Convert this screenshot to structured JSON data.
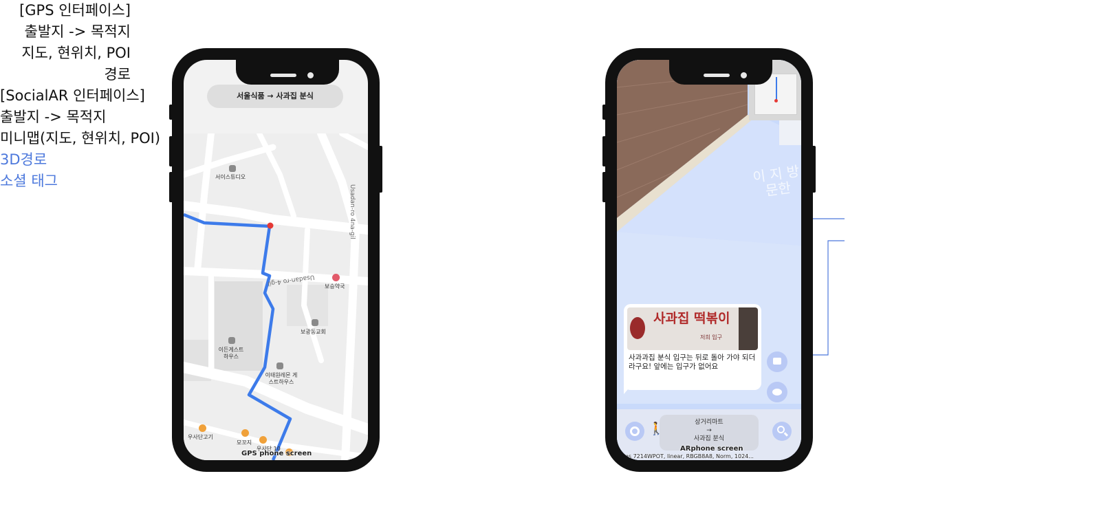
{
  "left_annotation": {
    "lines": [
      "[GPS 인터페이스]",
      "출발지 -> 목적지",
      "지도, 현위치, POI",
      "경로"
    ]
  },
  "right_annotation": {
    "lines": [
      "[SocialAR 인터페이스]",
      "출발지 -> 목적지",
      "미니맵(지도, 현위치, POI)"
    ],
    "route_label": "3D경로",
    "tag_label": "소셜 태그"
  },
  "gps_phone": {
    "route_text": "서울식품  → 사과집 분식",
    "street_labels": [
      "Usadan-ro 4na-gil",
      "Usadan-ro 4-gil"
    ],
    "pois": [
      "서이스튜디오",
      "보승약국",
      "보광동교회",
      "이든게스트하우스",
      "이태원레몬 게스트하우스",
      "우사단고기",
      "모꼬지",
      "우사단 10"
    ],
    "caption": "GPS phone screen",
    "colors": {
      "route": "#3d7bea",
      "current_location": "#e53935",
      "poi_orange": "#f0a13a"
    }
  },
  "ar_phone": {
    "sign_text": "사과집 떡볶이",
    "sign_subtext": "저희 입구",
    "tag_message": "사과과집 분식 입구는 뒤로 돌아 가야 되더라구요! 앞에는 입구가 없어요",
    "wall_text": "이 지 방문한",
    "nav_from": "상거리마트",
    "nav_arrow": "→",
    "nav_to": "사과집 분식",
    "caption": "ARphone screen",
    "debug_text": "0ms 7214WPOT, linear, RBGB8A8, Norm, 1024...",
    "icons": [
      "settings-icon",
      "walk-icon",
      "search-icon",
      "chat-icon",
      "sticker-icon"
    ],
    "colors": {
      "path": "#c9dafb",
      "wall": "#8a6a5a",
      "accent": "#4c78dc"
    }
  }
}
